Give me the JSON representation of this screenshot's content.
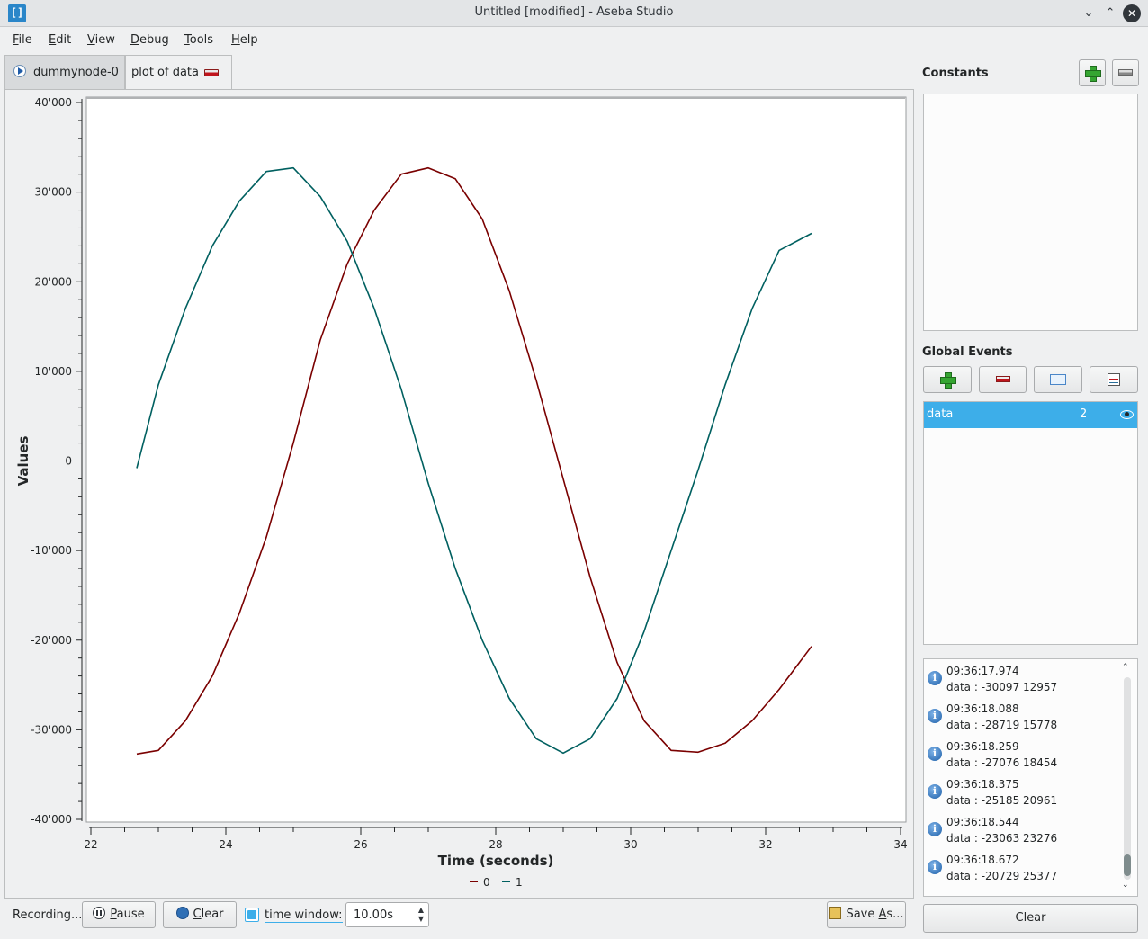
{
  "window": {
    "title": "Untitled [modified] - Aseba Studio",
    "icon": "aseba-icon",
    "icon_glyph": "[]",
    "controls": [
      "chevron-down-icon",
      "chevron-up-icon",
      "close-icon"
    ]
  },
  "menu": [
    {
      "label": "File",
      "accel": "F",
      "rest": "ile"
    },
    {
      "label": "Edit",
      "accel": "E",
      "rest": "dit"
    },
    {
      "label": "View",
      "accel": "V",
      "rest": "iew"
    },
    {
      "label": "Debug",
      "accel": "D",
      "rest": "ebug"
    },
    {
      "label": "Tools",
      "accel": "T",
      "rest": "ools"
    },
    {
      "label": "Help",
      "accel": "H",
      "rest": "elp"
    }
  ],
  "tabs": [
    {
      "label": "dummynode-0",
      "icon": "play-icon",
      "active": false
    },
    {
      "label": "plot of data",
      "icon": "close-tab-icon",
      "active": true
    }
  ],
  "plot_controls": {
    "status": "Recording...",
    "pause_accel": "P",
    "pause_rest": "ause",
    "clear_accel": "C",
    "clear_rest": "lear",
    "time_window_label_a": "time ",
    "time_window_accel": "w",
    "time_window_label_b": "indow:",
    "time_window_checked": true,
    "time_window_value": "10.00s",
    "save_a": "Save ",
    "save_accel": "A",
    "save_b": "s..."
  },
  "right_panel": {
    "constants_title": "Constants",
    "global_events_title": "Global Events",
    "events": [
      {
        "name": "data",
        "count": "2",
        "visible": true
      }
    ],
    "log": [
      {
        "time": "09:36:17.974",
        "data": "data : -30097 12957"
      },
      {
        "time": "09:36:18.088",
        "data": "data : -28719 15778"
      },
      {
        "time": "09:36:18.259",
        "data": "data : -27076 18454"
      },
      {
        "time": "09:36:18.375",
        "data": "data : -25185 20961"
      },
      {
        "time": "09:36:18.544",
        "data": "data : -23063 23276"
      },
      {
        "time": "09:36:18.672",
        "data": "data : -20729 25377"
      }
    ],
    "clear_label": "Clear"
  },
  "chart_data": {
    "type": "line",
    "title": "",
    "xlabel": "Time (seconds)",
    "ylabel": "Values",
    "xlim": [
      22,
      34
    ],
    "ylim": [
      -40000,
      40000
    ],
    "xticks": [
      22,
      24,
      26,
      28,
      30,
      32,
      34
    ],
    "yticks": [
      40000,
      30000,
      20000,
      10000,
      0,
      -10000,
      -20000,
      -30000,
      -40000
    ],
    "ytick_labels": [
      "40'000",
      "30'000",
      "20'000",
      "10'000",
      "0",
      "-10'000",
      "-20'000",
      "-30'000",
      "-40'000"
    ],
    "legend": "bottom-center",
    "grid": false,
    "series": [
      {
        "name": "0",
        "color": "#7a0000",
        "x": [
          22.68,
          23.0,
          23.4,
          23.8,
          24.2,
          24.6,
          25.0,
          25.4,
          25.8,
          26.2,
          26.6,
          27.0,
          27.4,
          27.8,
          28.2,
          28.6,
          29.0,
          29.4,
          29.8,
          30.2,
          30.6,
          31.0,
          31.4,
          31.8,
          32.2,
          32.68
        ],
        "y": [
          -32700,
          -32300,
          -29000,
          -24000,
          -17000,
          -8500,
          2000,
          13500,
          22000,
          28000,
          32000,
          32700,
          31500,
          27000,
          19000,
          9000,
          -2000,
          -13000,
          -22500,
          -29000,
          -32300,
          -32500,
          -31500,
          -29000,
          -25500,
          -20700
        ]
      },
      {
        "name": "1",
        "color": "#006060",
        "x": [
          22.68,
          23.0,
          23.4,
          23.8,
          24.2,
          24.6,
          25.0,
          25.4,
          25.8,
          26.2,
          26.6,
          27.0,
          27.4,
          27.8,
          28.2,
          28.6,
          29.0,
          29.4,
          29.8,
          30.2,
          30.6,
          31.0,
          31.4,
          31.8,
          32.2,
          32.68
        ],
        "y": [
          -800,
          8500,
          17000,
          24000,
          29000,
          32300,
          32700,
          29500,
          24500,
          17000,
          8000,
          -2500,
          -12000,
          -20000,
          -26500,
          -31000,
          -32600,
          -31000,
          -26500,
          -19000,
          -10000,
          -1000,
          8500,
          17000,
          23500,
          25400
        ]
      }
    ]
  }
}
